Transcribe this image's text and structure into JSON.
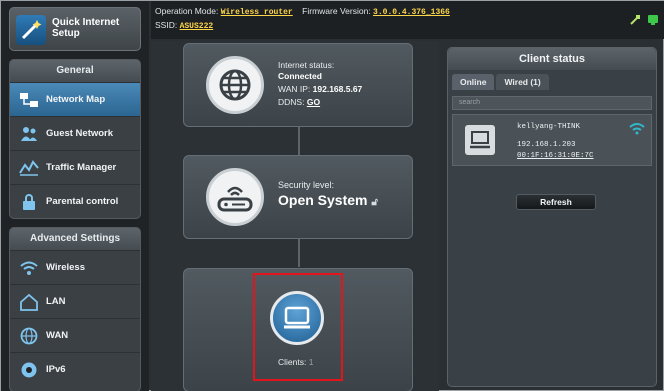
{
  "sidebar": {
    "quick_setup_label": "Quick Internet Setup",
    "general_header": "General",
    "general_items": [
      {
        "label": "Network Map",
        "icon": "network-map-icon",
        "active": true
      },
      {
        "label": "Guest Network",
        "icon": "guest-network-icon",
        "active": false
      },
      {
        "label": "Traffic Manager",
        "icon": "traffic-manager-icon",
        "active": false
      },
      {
        "label": "Parental control",
        "icon": "parental-control-icon",
        "active": false
      }
    ],
    "advanced_header": "Advanced Settings",
    "advanced_items": [
      {
        "label": "Wireless",
        "icon": "wireless-icon"
      },
      {
        "label": "LAN",
        "icon": "lan-icon"
      },
      {
        "label": "WAN",
        "icon": "wan-icon"
      },
      {
        "label": "IPv6",
        "icon": "ipv6-icon"
      }
    ]
  },
  "topbar": {
    "operation_mode_label": "Operation Mode:",
    "operation_mode_value": "Wireless router",
    "firmware_label": "Firmware Version:",
    "firmware_value": "3.0.0.4.376_1366",
    "ssid_label": "SSID:",
    "ssid_value": "ASUS222"
  },
  "map": {
    "internet": {
      "status_label": "Internet status:",
      "status_value": "Connected",
      "wan_ip_label": "WAN IP:",
      "wan_ip_value": "192.168.5.67",
      "ddns_label": "DDNS:",
      "ddns_value": "GO"
    },
    "security": {
      "level_label": "Security level:",
      "level_value": "Open System"
    },
    "clients": {
      "label": "Clients:",
      "count": "1"
    }
  },
  "client_status": {
    "title": "Client status",
    "tabs": [
      {
        "label": "Online",
        "active": true
      },
      {
        "label": "Wired (1)",
        "active": false
      }
    ],
    "search_placeholder": "search",
    "clients": [
      {
        "name": "kellyang-THINK",
        "ip": "192.168.1.203",
        "mac": "00:1F:16:31:0E:7C"
      }
    ],
    "refresh_label": "Refresh"
  },
  "colors": {
    "accent": "#2c6591",
    "highlight": "#e3151a",
    "value_yellow": "#ffd54a"
  }
}
